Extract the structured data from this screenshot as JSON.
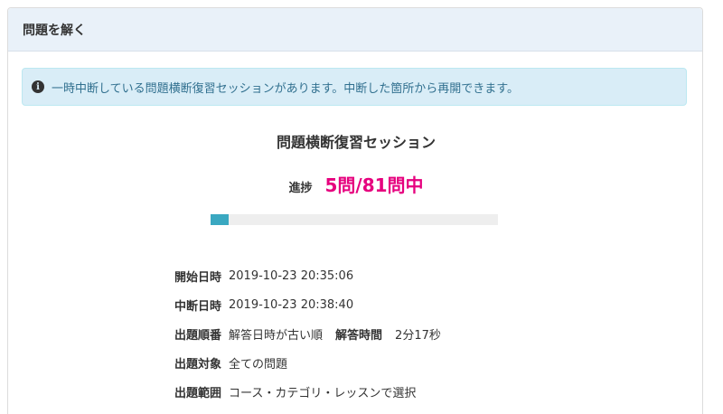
{
  "panel": {
    "title": "問題を解く"
  },
  "alert": {
    "icon": "info-icon",
    "text": "一時中断している問題横断復習セッションがあります。中断した箇所から再開できます。"
  },
  "session": {
    "title": "問題横断復習セッション",
    "progress_label": "進捗",
    "progress_text": "5問/81問中",
    "progress_current": 5,
    "progress_total": 81,
    "accent_color": "#e6007e",
    "bar_color": "#3aa8c1"
  },
  "details": {
    "start": {
      "label": "開始日時",
      "value": "2019-10-23 20:35:06"
    },
    "pause": {
      "label": "中断日時",
      "value": "2019-10-23 20:38:40"
    },
    "order": {
      "label": "出題順番",
      "value": "解答日時が古い順"
    },
    "answer_time": {
      "label": "解答時間",
      "value": "2分17秒"
    },
    "target": {
      "label": "出題対象",
      "value": "全ての問題"
    },
    "scope": {
      "label": "出題範囲",
      "value": "コース・カテゴリ・レッスンで選択"
    }
  }
}
